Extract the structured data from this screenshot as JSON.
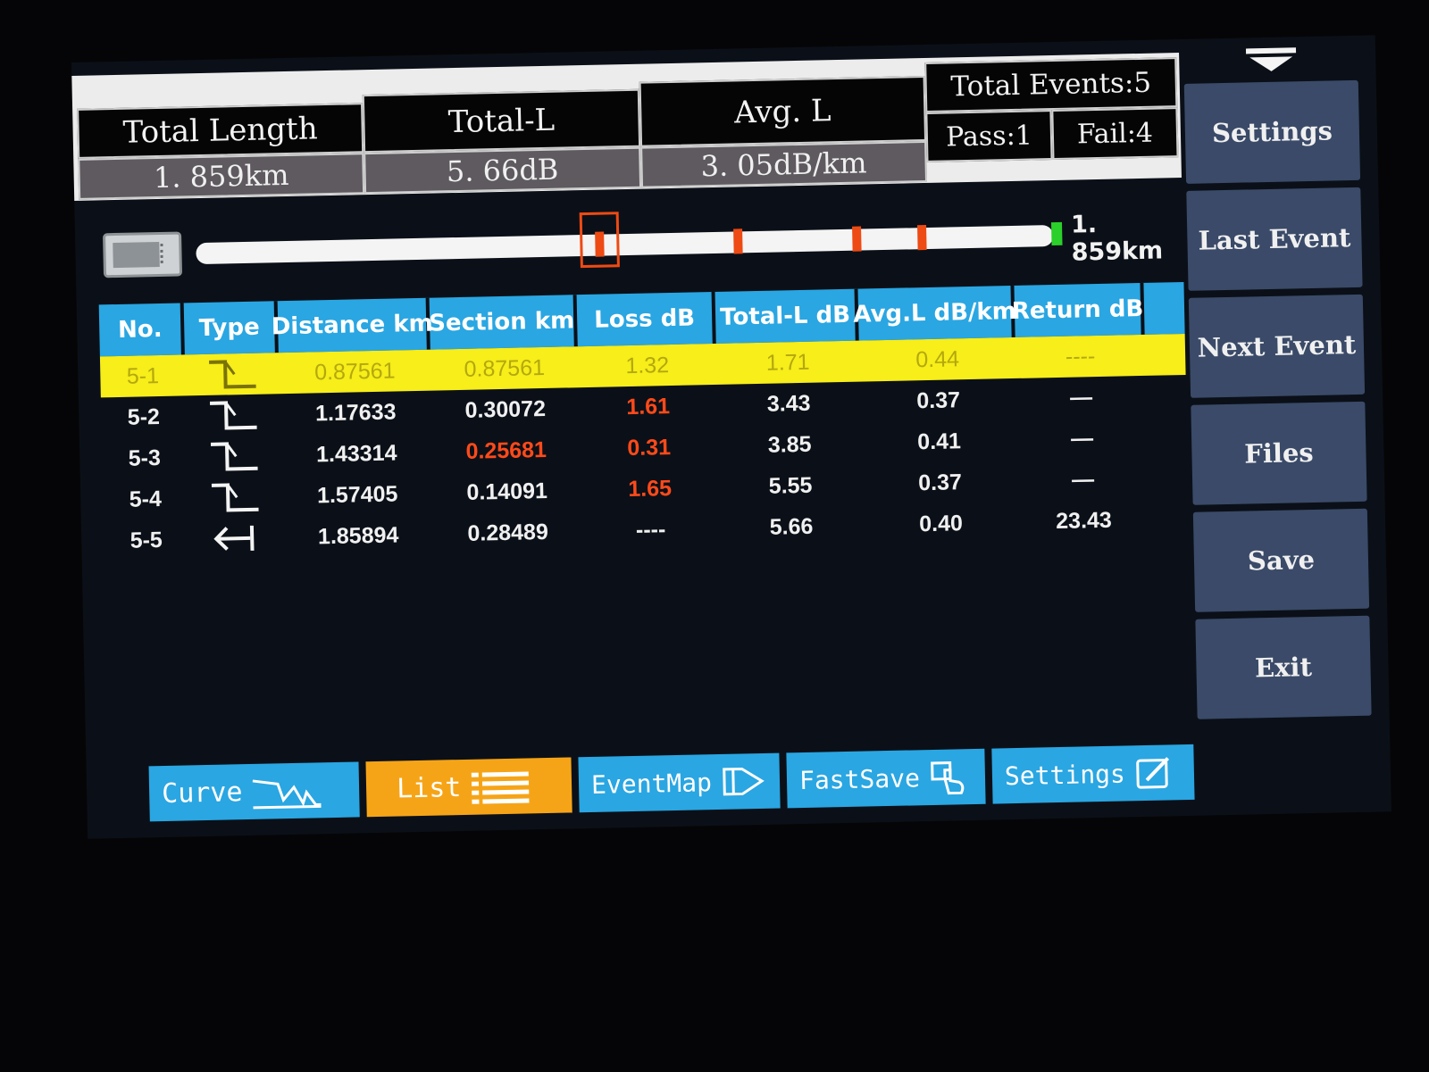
{
  "summary": {
    "total_length_label": "Total Length",
    "total_length_value": "1. 859km",
    "total_loss_label": "Total-L",
    "total_loss_value": "5. 66dB",
    "avg_loss_label": "Avg. L",
    "avg_loss_value": "3. 05dB/km",
    "total_events_label": "Total Events:5",
    "pass_label": "Pass:1",
    "fail_label": "Fail:4"
  },
  "fiber_map": {
    "length_label": "1. 859km",
    "event_positions_km": [
      0.87561,
      1.17633,
      1.43314,
      1.57405
    ],
    "selected_event": "5-1",
    "fiber_length_km": 1.85894,
    "colors": {
      "line": "#f4f4f4",
      "event": "#ee4a14",
      "end": "#2bd02b"
    }
  },
  "table": {
    "headers": {
      "no": "No.",
      "type": "Type",
      "distance": "Distance km",
      "section": "Section km",
      "loss": "Loss dB",
      "total_l": "Total-L dB",
      "avg_l": "Avg.L dB/km",
      "return": "Return dB"
    },
    "rows": [
      {
        "no": "5-1",
        "type": "step-icon",
        "distance": "0.87561",
        "section": "0.87561",
        "loss": "1.32",
        "total_l": "1.71",
        "avg_l": "0.44",
        "return": "----"
      },
      {
        "no": "5-2",
        "type": "step-icon",
        "distance": "1.17633",
        "section": "0.30072",
        "loss": "1.61",
        "total_l": "3.43",
        "avg_l": "0.37",
        "return": "—"
      },
      {
        "no": "5-3",
        "type": "step-icon",
        "distance": "1.43314",
        "section": "0.25681",
        "loss": "0.31",
        "total_l": "3.85",
        "avg_l": "0.41",
        "return": "—"
      },
      {
        "no": "5-4",
        "type": "step-icon",
        "distance": "1.57405",
        "section": "0.14091",
        "loss": "1.65",
        "total_l": "5.55",
        "avg_l": "0.37",
        "return": "—"
      },
      {
        "no": "5-5",
        "type": "fiber-end-icon",
        "distance": "1.85894",
        "section": "0.28489",
        "loss": "----",
        "total_l": "5.66",
        "avg_l": "0.40",
        "return": "23.43"
      }
    ],
    "selected_row": 0,
    "warn_color": "#ff4a1a",
    "highlight_color": "#f7ee1a"
  },
  "side_panel": {
    "buttons": [
      "Settings",
      "Last Event",
      "Next Event",
      "Files",
      "Save",
      "Exit"
    ]
  },
  "tabs": {
    "curve": "Curve",
    "list": "List",
    "eventmap": "EventMap",
    "fastsave": "FastSave",
    "settings": "Settings",
    "active": "List"
  }
}
